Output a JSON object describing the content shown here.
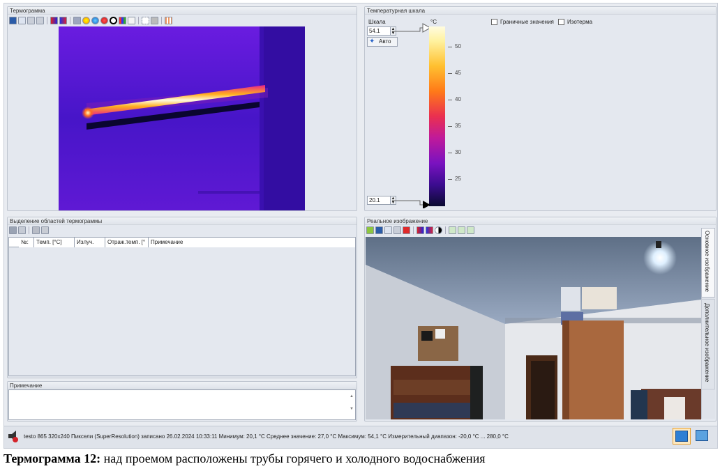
{
  "thermogram": {
    "title": "Термограмма"
  },
  "scale": {
    "title": "Температурная шкала",
    "label": "Шкала",
    "unit": "°C",
    "max_value": "54.1",
    "min_value": "20.1",
    "auto_label": "Авто",
    "boundary_label": "Граничные значения",
    "isotherm_label": "Изотерма",
    "ticks": [
      "50",
      "45",
      "40",
      "35",
      "30",
      "25"
    ]
  },
  "areas": {
    "title": "Выделение областей термограммы",
    "columns": [
      "№:",
      "Темп. [°C]",
      "Излуч.",
      "Отраж.темп. [°",
      "Примечание"
    ]
  },
  "note": {
    "title": "Примечание",
    "value": ""
  },
  "real": {
    "title": "Реальное изображение",
    "tabs": [
      "Основное изображение",
      "Дополнительное изображение"
    ]
  },
  "status": {
    "text": "testo 865 320x240 Пиксели (SuperResolution) записано 26.02.2024 10:33:11 Минимум: 20,1 °C Среднее значение: 27,0 °C Максимум: 54,1 °C Измерительный диапазон: -20,0 °C ... 280,0 °C"
  },
  "caption": {
    "bold": "Термограмма 12:",
    "text": " над проемом расположены трубы горячего и холодного водоснабжения"
  },
  "colors": {
    "iron_top": "#fffce0",
    "iron_bottom": "#0a0a30",
    "background": "#e9ecf1"
  }
}
